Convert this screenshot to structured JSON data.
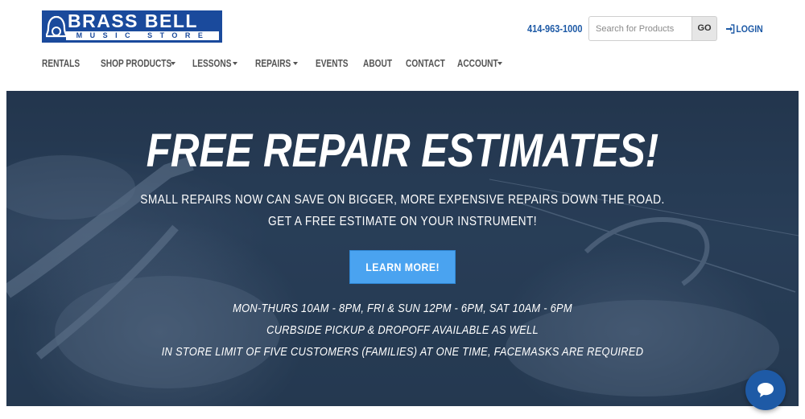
{
  "brand": {
    "name_line1": "BRASS BELL",
    "name_line2": "MUSIC STORE",
    "primary_color": "#1a4a9c"
  },
  "header": {
    "phone": "414-963-1000",
    "search": {
      "placeholder": "Search for Products",
      "button_label": "GO"
    },
    "login_label": "LOGIN",
    "login_icon": "sign-in-icon",
    "link_color": "#1e5aa6"
  },
  "nav": {
    "items": [
      {
        "label": "RENTALS",
        "dropdown": false
      },
      {
        "label": "SHOP PRODUCTS",
        "dropdown": true
      },
      {
        "label": "LESSONS",
        "dropdown": true
      },
      {
        "label": "REPAIRS",
        "dropdown": true
      },
      {
        "label": "EVENTS",
        "dropdown": false
      },
      {
        "label": "ABOUT",
        "dropdown": false
      },
      {
        "label": "CONTACT",
        "dropdown": false
      },
      {
        "label": "ACCOUNT",
        "dropdown": true
      }
    ]
  },
  "hero": {
    "title": "FREE REPAIR ESTIMATES!",
    "subtitle_line1": "SMALL REPAIRS NOW CAN SAVE ON BIGGER, MORE EXPENSIVE REPAIRS DOWN THE ROAD.",
    "subtitle_line2": "GET A FREE ESTIMATE ON YOUR INSTRUMENT!",
    "cta_label": "LEARN MORE!",
    "cta_color": "#4aa3f0",
    "info_line1": "MON-THURS 10AM - 8PM, FRI & SUN 12PM - 6PM, SAT 10AM - 6PM",
    "info_line2": "CURBSIDE PICKUP & DROPOFF AVAILABLE AS WELL",
    "info_line3": "IN STORE LIMIT OF FIVE CUSTOMERS (FAMILIES) AT ONE TIME, FACEMASKS ARE REQUIRED"
  },
  "chat": {
    "icon": "chat-bubble-icon",
    "color": "#1e5aa6"
  }
}
